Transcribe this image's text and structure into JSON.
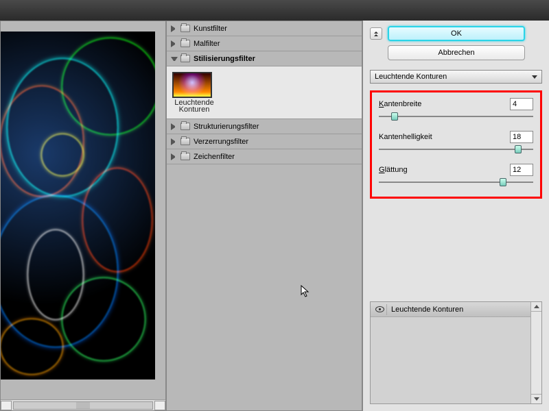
{
  "buttons": {
    "ok": "OK",
    "cancel": "Abbrechen"
  },
  "filter_dropdown": {
    "selected": "Leuchtende Konturen"
  },
  "tree": {
    "items": [
      {
        "label": "Kunstfilter",
        "expanded": false
      },
      {
        "label": "Malfilter",
        "expanded": false
      },
      {
        "label": "Stilisierungsfilter",
        "expanded": true
      },
      {
        "label": "Strukturierungsfilter",
        "expanded": false
      },
      {
        "label": "Verzerrungsfilter",
        "expanded": false
      },
      {
        "label": "Zeichenfilter",
        "expanded": false
      }
    ],
    "thumb": {
      "label_line1": "Leuchtende",
      "label_line2": "Konturen"
    }
  },
  "params": [
    {
      "key": "K",
      "rest": "antenbreite",
      "label_full": "Kantenbreite",
      "value": "4",
      "pos_pct": 8
    },
    {
      "key": "",
      "rest": "Kantenhelligkeit",
      "label_full": "Kantenhelligkeit",
      "value": "18",
      "pos_pct": 88
    },
    {
      "key": "G",
      "rest": "lättung",
      "label_full": "Glättung",
      "value": "12",
      "pos_pct": 78
    }
  ],
  "layers": {
    "active": "Leuchtende Konturen"
  }
}
